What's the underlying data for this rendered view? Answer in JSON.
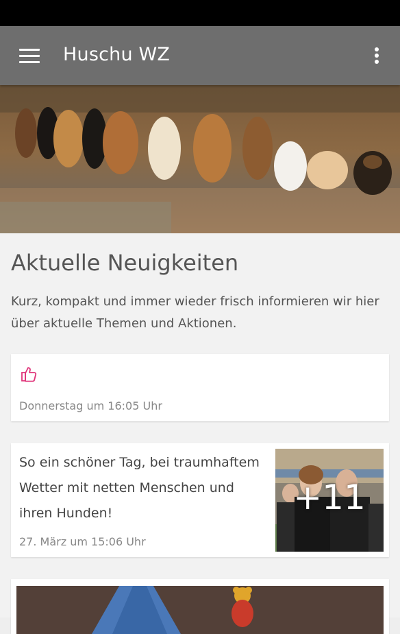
{
  "app": {
    "title": "Huschu WZ",
    "menu_icon": "hamburger-menu-icon",
    "overflow_icon": "more-vertical-icon",
    "toolbar_color": "#6e6e6e"
  },
  "news": {
    "heading": "Aktuelle Neuigkeiten",
    "intro": "Kurz, kompakt und immer wieder frisch informieren wir hier über aktuelle Themen und Aktionen."
  },
  "posts": [
    {
      "icon": "thumbs-up-icon",
      "icon_color": "#e0357a",
      "time": "Donnerstag um 16:05 Uhr"
    },
    {
      "text": "So ein schöner Tag, bei traumhaftem Wetter mit netten Menschen und ihren Hunden!",
      "time": "27. März um 15:06 Uhr",
      "photo_count": "+11"
    }
  ]
}
